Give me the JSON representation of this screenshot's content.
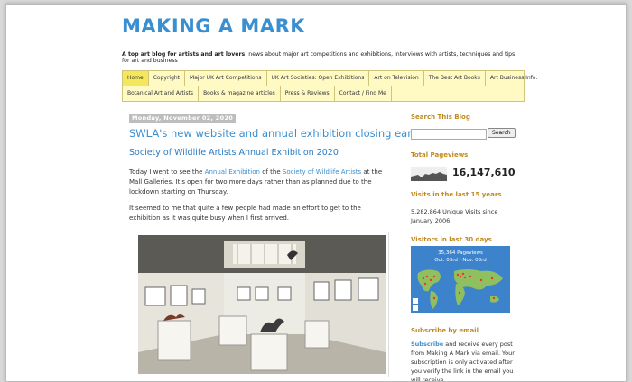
{
  "blog": {
    "title": "MAKING A MARK",
    "tagline_bold": "A top art blog for artists and art lovers",
    "tagline_rest": ": news about major art competitions and exhibitions, interviews with artists, techniques and tips for art and business"
  },
  "nav": {
    "row1": [
      "Home",
      "Copyright",
      "Major UK Art Competitions",
      "UK Art Societies: Open Exhibitions",
      "Art on Television",
      "The Best Art Books",
      "Art Business Info."
    ],
    "row2": [
      "Botanical Art and Artists",
      "Books & magazine articles",
      "Press & Reviews",
      "Contact / Find Me"
    ]
  },
  "post": {
    "date": "Monday, November 02, 2020",
    "title": "SWLA's new website and annual exhibition closing early",
    "subtitle": "Society of Wildlife Artists Annual Exhibition 2020",
    "p1_a": "Today I went to see the ",
    "p1_link1": "Annual Exhibition",
    "p1_b": " of the ",
    "p1_link2": "Society of Wildlife Artists",
    "p1_c": " at the Mall Galleries. It's open for two more days rather than as planned due to the lockdown starting on Thursday.",
    "p2": "It seemed to me that quite a few people had made an effort to get to the exhibition as it was quite busy when I first arrived."
  },
  "sidebar": {
    "search_title": "Search This Blog",
    "search_button": "Search",
    "pageviews_title": "Total Pageviews",
    "pageviews_count": "16,147,610",
    "visits15_title": "Visits in the last 15 years",
    "visits15_text": "5,282,864 Unique Visits since January 2006",
    "visitors30_title": "Visitors in last 30 days",
    "map_pageviews": "35,364 Pageviews",
    "map_range": "Oct. 03rd - Nov. 03rd",
    "subscribe_title": "Subscribe by email",
    "subscribe_link": "Subscribe",
    "subscribe_text": " and receive every post from Making A Mark via email. Your subscription is only activated after you verify the link in the email you will receive"
  },
  "colors": {
    "title_blue": "#3a8fd1",
    "nav_yellow": "#fff9c4",
    "sidebar_heading": "#c08a20"
  }
}
